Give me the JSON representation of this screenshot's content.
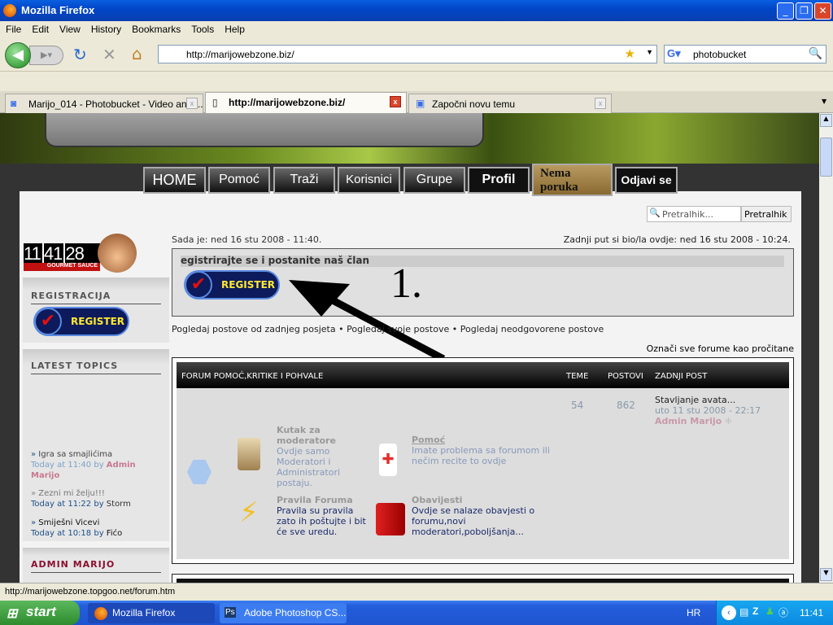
{
  "window": {
    "title": "Mozilla Firefox"
  },
  "menu": [
    "File",
    "Edit",
    "View",
    "History",
    "Bookmarks",
    "Tools",
    "Help"
  ],
  "toolbar": {
    "url": "http://marijowebzone.biz/",
    "search_value": "photobucket"
  },
  "tabs": [
    {
      "label": "Marijo_014 - Photobucket - Video and I..."
    },
    {
      "label": "http://marijowebzone.biz/"
    },
    {
      "label": "Započni novu temu"
    }
  ],
  "site": {
    "nav": [
      "HOME",
      "Pomoć",
      "Traži",
      "Korisnici",
      "Grupe",
      "Profil",
      "Nema poruka",
      "Odjavi se"
    ],
    "search": {
      "placeholder": "Pretralhik...",
      "button": "Pretralhik"
    },
    "clock": {
      "h": "11",
      "m": "41",
      "s": "28",
      "brand": "GOURMET SAUCE"
    },
    "sidebar": {
      "registracija": "REGISTRACIJA",
      "register": "REGISTER",
      "latest": "LATEST TOPICS",
      "admin": "ADMIN MARIJO",
      "topics": [
        {
          "title": "Igra sa smajlićima",
          "time": "Today at 11:40",
          "by": "by",
          "user": "Admin Marijo"
        },
        {
          "title": "Zezni mi želju!!!",
          "time": "Today at 11:22",
          "by": "by",
          "user": "Storm"
        },
        {
          "title": "Smiješni Vicevi",
          "time": "Today at 10:18",
          "by": "by",
          "user": "Fićo"
        }
      ]
    },
    "now": "Sada je: ned 16 stu 2008 - 11:40.",
    "last_visit": "Zadnji put si bio/la ovdje: ned 16 stu 2008 - 10:24.",
    "register_banner": "egistrirajte se i postanite naš član",
    "annotation": "1.",
    "links": [
      "Pogledaj postove od zadnjeg posjeta",
      "Pogledaj svoje postove",
      "Pogledaj neodgovorene postove"
    ],
    "bullet": "•",
    "mark_read": "Označi sve forume kao pročitane",
    "table": {
      "headers": [
        "FORUM POMOĆ,KRITIKE I POHVALE",
        "TEME",
        "POSTOVI",
        "ZADNJI POST"
      ],
      "teme": "54",
      "postovi": "862",
      "last": {
        "title": "Stavljanje avata...",
        "date": "uto 11 stu 2008 - 22:17",
        "user": "Admin Marijo"
      },
      "forums": [
        {
          "title": "Kutak za moderatore",
          "desc": "Ovdje samo Moderatori i Administratori postaju."
        },
        {
          "title": "Pomoć",
          "desc": "Imate problema sa forumom ili nečim recite to ovdje"
        },
        {
          "title": "Pravila Foruma",
          "desc": "Pravila su pravila zato ih poštujte i bit će sve uredu."
        },
        {
          "title": "Obavijesti",
          "desc": "Ovdje se nalaze obavjesti o forumu,novi moderatori,poboljšanja..."
        }
      ]
    }
  },
  "status": "http://marijowebzone.topgoo.net/forum.htm",
  "taskbar": {
    "start": "start",
    "tasks": [
      "Mozilla Firefox",
      "Adobe Photoshop CS..."
    ],
    "lang": "HR",
    "clock": "11:41"
  }
}
